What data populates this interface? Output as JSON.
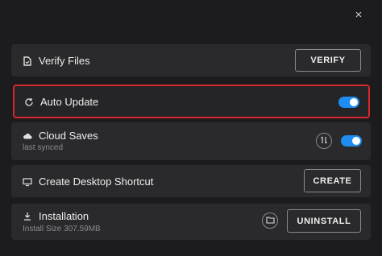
{
  "dialog": {
    "close_glyph": "×"
  },
  "rows": {
    "verify": {
      "label": "Verify Files",
      "button": "VERIFY",
      "icon": "file-check-icon"
    },
    "auto_update": {
      "label": "Auto Update",
      "enabled": true,
      "icon": "refresh-icon"
    },
    "cloud_saves": {
      "label": "Cloud Saves",
      "sublabel": "last synced",
      "enabled": true,
      "icon": "cloud-upload-icon",
      "sync_icon": "sync-icon"
    },
    "shortcut": {
      "label": "Create Desktop Shortcut",
      "button": "CREATE",
      "icon": "monitor-icon"
    },
    "installation": {
      "label": "Installation",
      "sublabel": "Install Size 307.59MB",
      "button": "UNINSTALL",
      "icon": "download-icon",
      "folder_icon": "folder-icon"
    }
  },
  "colors": {
    "accent": "#1e8cf0",
    "highlight": "#d6262e",
    "background": "#1c1c1e",
    "row": "#2a2a2c"
  }
}
